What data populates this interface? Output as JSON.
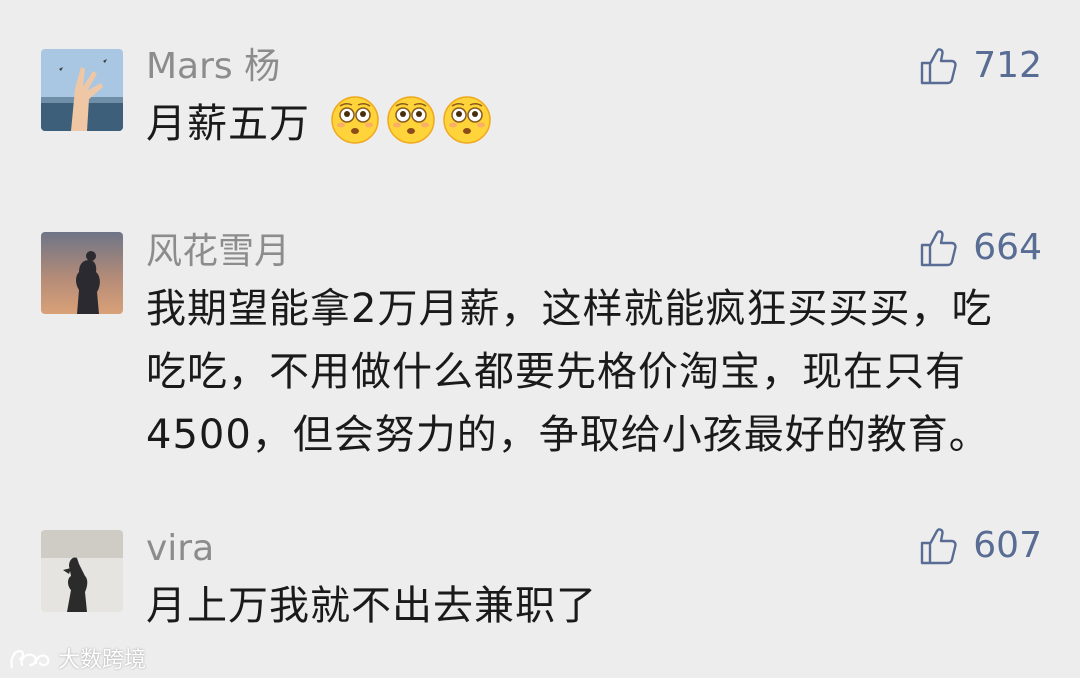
{
  "comments": [
    {
      "nickname": "Mars 杨",
      "likes": "712",
      "text": "月薪五万",
      "emoji": [
        "flushed-face-emoji",
        "flushed-face-emoji",
        "flushed-face-emoji"
      ]
    },
    {
      "nickname": "风花雪月",
      "likes": "664",
      "text": "我期望能拿2万月薪，这样就能疯狂买买买，吃吃吃，不用做什么都要先格价淘宝，现在只有4500，但会努力的，争取给小孩最好的教育。"
    },
    {
      "nickname": "vira",
      "likes": "607",
      "text": "月上万我就不出去兼职了"
    }
  ],
  "watermark": {
    "text": "大数跨境",
    "icon": "brand-logo-icon"
  },
  "colors": {
    "background": "#ededed",
    "nickname": "#8c8c8c",
    "like_accent": "#586c94",
    "text": "#1a1a1a"
  }
}
